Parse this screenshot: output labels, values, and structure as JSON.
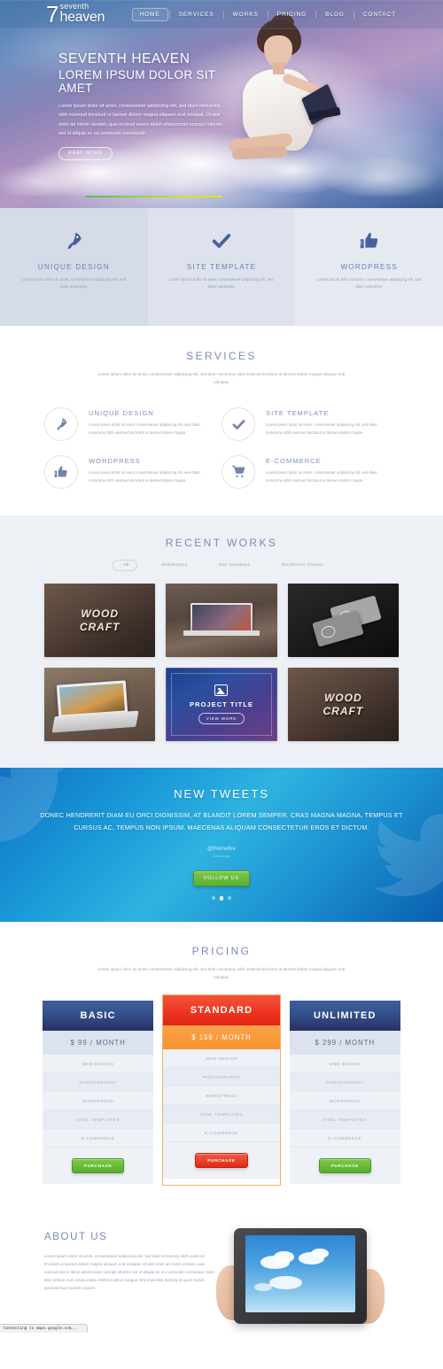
{
  "site": {
    "logo_number": "7",
    "logo_line1": "seventh",
    "logo_line2": "heaven"
  },
  "nav": {
    "items": [
      {
        "label": "HOME",
        "active": true
      },
      {
        "label": "SERVICES",
        "active": false
      },
      {
        "label": "WORKS",
        "active": false
      },
      {
        "label": "PRICING",
        "active": false
      },
      {
        "label": "BLOG",
        "active": false
      },
      {
        "label": "CONTACT",
        "active": false
      }
    ]
  },
  "hero": {
    "heading": "SEVENTH HEAVEN",
    "subheading": "LOREM IPSUM DOLOR SIT AMET",
    "paragraph": "Lorem ipsum dolor sit amet, consectetuer adipiscing elit, sed diam nonummy nibh euismod tincidunt ut laoreet dolore magna aliquam erat volutpat. Ut wisi enim ad minim veniam, quis nostrud exerci tation ullamcorper suscipit lobortis nisl ut aliquip ex ea commodo consequat.",
    "button_label": "READ MORE"
  },
  "features": {
    "items": [
      {
        "icon": "rocket-icon",
        "title": "UNIQUE DESIGN",
        "text": "Lorem ipsum dolor sit amet, consectetuer adipiscing elit, sed diam nonummy."
      },
      {
        "icon": "check-icon",
        "title": "SITE TEMPLATE",
        "text": "Lorem ipsum dolor sit amet, consectetuer adipiscing elit, sed diam nonummy."
      },
      {
        "icon": "thumbs-up-icon",
        "title": "WORDPRESS",
        "text": "Lorem ipsum dolor sit amet, consectetuer adipiscing elit, sed diam nonummy."
      }
    ]
  },
  "services": {
    "title": "SERVICES",
    "subtitle": "Lorem ipsum dolor sit amet, consectetuer adipiscing elit, sed diam nonummy nibh euismod tincidunt ut laoreet dolore magna aliquam erat volutpat.",
    "items": [
      {
        "icon": "rocket-icon",
        "title": "UNIQUE DESIGN",
        "text": "Lorem ipsum dolor sit amet, consectetuer adipiscing elit, sed diam nonummy nibh euismod tincidunt ut laoreet dolore magna"
      },
      {
        "icon": "check-icon",
        "title": "SITE TEMPLATE",
        "text": "Lorem ipsum dolor sit amet, consectetuer adipiscing elit, sed diam nonummy nibh euismod tincidunt ut laoreet dolore magna"
      },
      {
        "icon": "thumbs-up-icon",
        "title": "WORDPRESS",
        "text": "Lorem ipsum dolor sit amet, consectetuer adipiscing elit, sed diam nonummy nibh euismod tincidunt ut laoreet dolore magna"
      },
      {
        "icon": "cart-icon",
        "title": "E-COMMERCE",
        "text": "Lorem ipsum dolor sit amet, consectetuer adipiscing elit, sed diam nonummy nibh euismod tincidunt ut laoreet dolore magna"
      }
    ]
  },
  "works": {
    "title": "RECENT WORKS",
    "filters": [
      {
        "label": "· All",
        "active": true
      },
      {
        "label": "· Webdesigns",
        "active": false
      },
      {
        "label": "· Site Templates",
        "active": false
      },
      {
        "label": "· WordPress Themes",
        "active": false
      }
    ],
    "items": [
      {
        "kind": "wood",
        "line1": "WOOD",
        "line2": "CRAFT"
      },
      {
        "kind": "laptop-room",
        "line1": "",
        "line2": ""
      },
      {
        "kind": "cards-dark",
        "line1": "",
        "line2": ""
      },
      {
        "kind": "laptop-sun",
        "line1": "",
        "line2": ""
      },
      {
        "kind": "project",
        "title": "PROJECT TITLE",
        "button": "VIEW WORK",
        "icon": "image-icon"
      },
      {
        "kind": "wood",
        "line1": "WOOD",
        "line2": "CRAFT"
      }
    ]
  },
  "tweets": {
    "title": "NEW TWEETS",
    "body": "DONEC HENDRERIT DIAM EU ORCI DIGNISSIM, AT BLANDIT LOREM SEMPER. CRAS MAGNA MAGNA, TEMPUS ET CURSUS AC, TEMPUS NON IPSUM. MAECENAS ALIQUAM CONSECTETUR EROS ET DICTUM.",
    "handle": "@themefire",
    "time": "5 hours ago",
    "button_label": "FOLLOW US",
    "dots": [
      false,
      true,
      false
    ]
  },
  "pricing": {
    "title": "PRICING",
    "subtitle": "Lorem ipsum dolor sit amet, consectetuer adipiscing elit, sed diam nonummy nibh euismod tincidunt ut laoreet dolore magna aliquam erat volutpat.",
    "plans": [
      {
        "name": "BASIC",
        "price": "$ 99 / MONTH",
        "featured": false,
        "features": [
          "WEB DESIGN",
          "PHOTOGRAPHY",
          "WORDPRESS",
          "HTML TEMPLATES",
          "E-COMMERCE"
        ],
        "cta": "PURCHASE"
      },
      {
        "name": "STANDARD",
        "price": "$ 159 / MONTH",
        "featured": true,
        "features": [
          "WEB DESIGN",
          "PHOTOGRAPHY",
          "WORDPRESS",
          "HTML TEMPLATES",
          "E-COMMERCE"
        ],
        "cta": "PURCHASE"
      },
      {
        "name": "UNLIMITED",
        "price": "$ 299 / MONTH",
        "featured": false,
        "features": [
          "WEB DESIGN",
          "PHOTOGRAPHY",
          "WORDPRESS",
          "HTML TEMPLATES",
          "E-COMMERCE"
        ],
        "cta": "PURCHASE"
      }
    ]
  },
  "about": {
    "title": "ABOUT US",
    "text": "Lorem ipsum dolor sit amet, consectetuer adipiscing elit, sed diam nonummy nibh euismod tincidunt ut laoreet dolore magna aliquam erat volutpat. Ut wisi enim ad minim veniam, quis nostrud exerci tation ullamcorper suscipit lobortis nisl ut aliquip ex ea commodo consequat. Nam liber tempor cum soluta nobis eleifend option congue nihil imperdiet doming id quod mazim placerat facer possim assum."
  },
  "browser": {
    "status_text": "Connecting to maps.google.com..."
  },
  "colors": {
    "accent_blue": "#6a7fbd",
    "heading_blue": "#7b8bb8",
    "plan_blue": "#33508c",
    "plan_red": "#ef3a24",
    "plan_orange": "#f8922f",
    "green_button": "#58ad2c",
    "twitter_blue": "#1a9ad8"
  }
}
